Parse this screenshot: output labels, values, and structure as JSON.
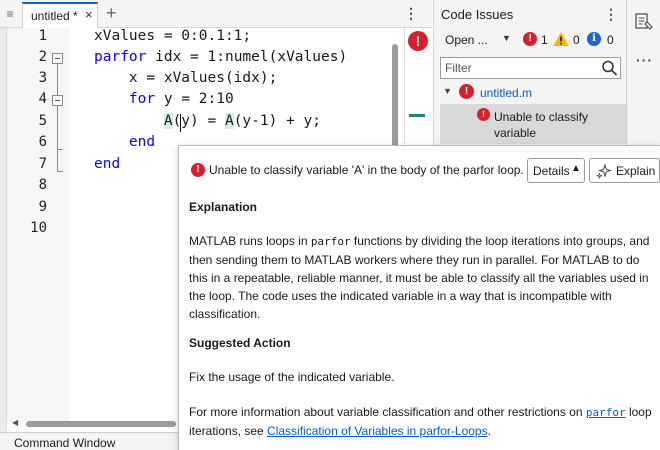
{
  "editor": {
    "tab_label": "untitled *",
    "tab_close": "×",
    "tab_add": "+",
    "menu": "⋮",
    "line_numbers": [
      "1",
      "2",
      "3",
      "4",
      "5",
      "6",
      "7",
      "8",
      "9",
      "10"
    ],
    "code": {
      "l1": "xValues = 0:0.1:1;",
      "l2_kw": "parfor",
      "l2_rest": " idx = 1:numel(xValues)",
      "l3": "    x = xValues(idx);",
      "l4_indent": "    ",
      "l4_kw": "for",
      "l4_rest": " y = 2:10",
      "l5_indent": "        ",
      "l5_a1": "A",
      "l5_mid": "(y) = ",
      "l5_a2": "A",
      "l5_end": "(y-1) + y;",
      "l6_indent": "    ",
      "l6_kw": "end",
      "l7_kw": "end"
    },
    "analyzer_badge": "!"
  },
  "command_window": {
    "title": "Command Window"
  },
  "code_issues": {
    "title": "Code Issues",
    "menu": "⋮",
    "open_select": "Open ...",
    "error_count": "1",
    "warning_count": "0",
    "info_count": "0",
    "filter_placeholder": "Filter",
    "file_name": "untitled.m",
    "issue_text": "Unable to classify variable"
  },
  "toolstrip": {
    "more": "···"
  },
  "popup": {
    "message": "Unable to classify variable 'A' in the body of the parfor loop.",
    "details_label": "Details",
    "details_caret": "▲",
    "explain_label": "Explain",
    "explanation_heading": "Explanation",
    "explanation_p1": "MATLAB runs loops in ",
    "explanation_code": "parfor",
    "explanation_p2": " functions by dividing the loop iterations into groups, and then sending them to MATLAB workers where they run in parallel. For MATLAB to do this in a repeatable, reliable manner, it must be able to classify all the variables used in the loop. The code uses the indicated variable in a way that is incompatible with classification.",
    "suggested_heading": "Suggested Action",
    "suggested_text": "Fix the usage of the indicated variable.",
    "more_p1": "For more information about variable classification and other restrictions on ",
    "more_code_link": "parfor",
    "more_p2": " loop iterations, see ",
    "more_link": "Classification of Variables in parfor-Loops",
    "more_p3": "."
  },
  "colors": {
    "error": "#d5202f",
    "warning": "#f2b705",
    "info": "#1f63d6",
    "keyword": "#0e00ff",
    "link": "#0a5bc4",
    "variable_highlight": "#d3efe0"
  }
}
